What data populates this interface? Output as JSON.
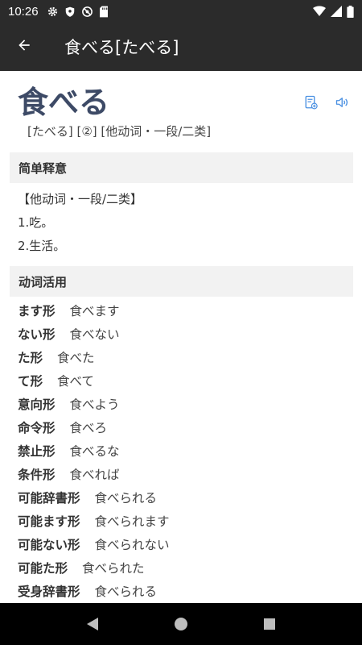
{
  "status_bar": {
    "time": "10:26",
    "left_icons": [
      "gear-icon",
      "shield-icon",
      "no-sync-icon",
      "sd-card-icon"
    ],
    "right_icons": [
      "wifi-icon",
      "signal-icon",
      "battery-icon"
    ]
  },
  "app_bar": {
    "title": "食べる[たべる]"
  },
  "entry": {
    "word": "食べる",
    "reading_line": "[たべる] [②] [他动词・一段/二类]"
  },
  "sections": {
    "meaning_header": "简单释意",
    "conjugation_header": "动词活用"
  },
  "definition": {
    "type": "【他动词・一段/二类】",
    "lines": [
      "1.吃。",
      "2.生活。"
    ]
  },
  "conjugations": [
    {
      "label": "ます形",
      "value": "食べます"
    },
    {
      "label": "ない形",
      "value": "食べない"
    },
    {
      "label": "た形",
      "value": "食べた"
    },
    {
      "label": "て形",
      "value": "食べて"
    },
    {
      "label": "意向形",
      "value": "食べよう"
    },
    {
      "label": "命令形",
      "value": "食べろ"
    },
    {
      "label": "禁止形",
      "value": "食べるな"
    },
    {
      "label": "条件形",
      "value": "食べれば"
    },
    {
      "label": "可能辞書形",
      "value": "食べられる"
    },
    {
      "label": "可能ます形",
      "value": "食べられます"
    },
    {
      "label": "可能ない形",
      "value": "食べられない"
    },
    {
      "label": "可能た形",
      "value": "食べられた"
    },
    {
      "label": "受身辞書形",
      "value": "食べられる"
    }
  ],
  "colors": {
    "bar_bg": "#2b2b2b",
    "title_color": "#3d4a66",
    "accent_blue": "#4a90e2",
    "section_bg": "#f2f2f2"
  }
}
